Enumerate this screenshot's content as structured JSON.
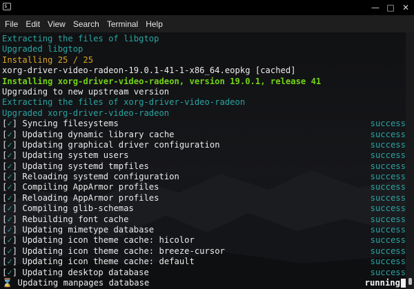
{
  "window": {
    "icon": "terminal-icon",
    "controls": [
      "minimize-icon",
      "maximize-icon",
      "close-icon"
    ],
    "control_glyphs": {
      "minimize": "—",
      "maximize": "□",
      "close": "✕"
    }
  },
  "menu": {
    "items": [
      "File",
      "Edit",
      "View",
      "Search",
      "Terminal",
      "Help"
    ]
  },
  "terminal": {
    "log": [
      {
        "text": "Extracting the files of libgtop",
        "color": "#2aa4a2"
      },
      {
        "text": "Upgraded libgtop",
        "color": "#2aa4a2"
      },
      {
        "text": "Installing 25 / 25",
        "color": "#d9a528"
      },
      {
        "text": "xorg-driver-video-radeon-19.0.1-41-1-x86_64.eopkg [cached]",
        "color": "#ececec"
      },
      {
        "text": "Installing xorg-driver-video-radeon, version 19.0.1, release 41",
        "color": "#73d216"
      },
      {
        "text": "Upgrading to new upstream version",
        "color": "#ececec"
      },
      {
        "text": "Extracting the files of xorg-driver-video-radeon",
        "color": "#2aa4a2"
      },
      {
        "text": "Upgraded xorg-driver-video-radeon",
        "color": "#2aa4a2"
      }
    ],
    "tasks": [
      {
        "mark": "[✓]",
        "label": "Syncing filesystems",
        "status": "success"
      },
      {
        "mark": "[✓]",
        "label": "Updating dynamic library cache",
        "status": "success"
      },
      {
        "mark": "[✓]",
        "label": "Updating graphical driver configuration",
        "status": "success"
      },
      {
        "mark": "[✓]",
        "label": "Updating system users",
        "status": "success"
      },
      {
        "mark": "[✓]",
        "label": "Updating systemd tmpfiles",
        "status": "success"
      },
      {
        "mark": "[✓]",
        "label": "Reloading systemd configuration",
        "status": "success"
      },
      {
        "mark": "[✓]",
        "label": "Compiling AppArmor profiles",
        "status": "success"
      },
      {
        "mark": "[✓]",
        "label": "Reloading AppArmor profiles",
        "status": "success"
      },
      {
        "mark": "[✓]",
        "label": "Compiling glib-schemas",
        "status": "success"
      },
      {
        "mark": "[✓]",
        "label": "Rebuilding font cache",
        "status": "success"
      },
      {
        "mark": "[✓]",
        "label": "Updating mimetype database",
        "status": "success"
      },
      {
        "mark": "[✓]",
        "label": "Updating icon theme cache: hicolor",
        "status": "success"
      },
      {
        "mark": "[✓]",
        "label": "Updating icon theme cache: breeze-cursor",
        "status": "success"
      },
      {
        "mark": "[✓]",
        "label": "Updating icon theme cache: default",
        "status": "success"
      },
      {
        "mark": "[✓]",
        "label": "Updating desktop database",
        "status": "success"
      },
      {
        "mark": "⌛",
        "label": "Updating manpages database",
        "status": "running"
      }
    ]
  }
}
